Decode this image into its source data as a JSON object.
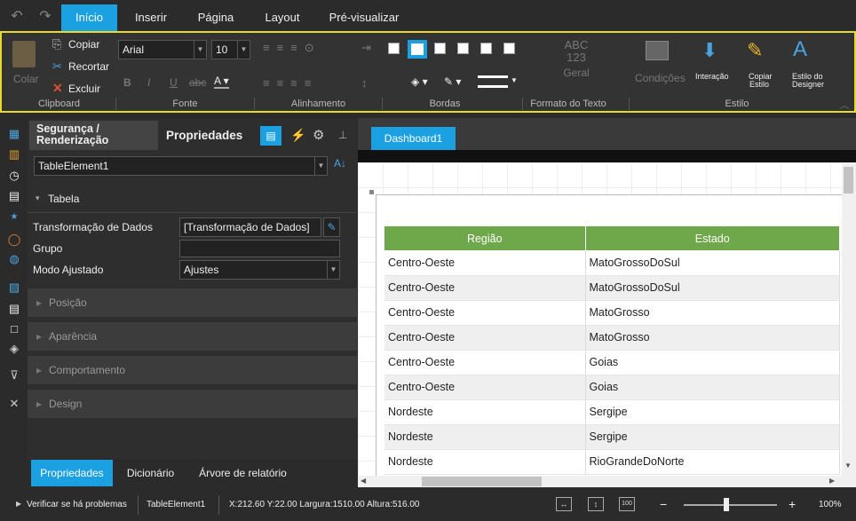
{
  "tabs": [
    {
      "label": "Início",
      "active": true
    },
    {
      "label": "Inserir",
      "active": false
    },
    {
      "label": "Página",
      "active": false
    },
    {
      "label": "Layout",
      "active": false
    },
    {
      "label": "Pré-visualizar",
      "active": false
    }
  ],
  "ribbon": {
    "clipboard": {
      "paste": "Colar",
      "copy": "Copiar",
      "cut": "Recortar",
      "delete": "Excluir",
      "group": "Clipboard"
    },
    "font": {
      "family": "Arial",
      "size": "10",
      "group": "Fonte"
    },
    "alignment": {
      "group": "Alinhamento"
    },
    "borders": {
      "group": "Bordas"
    },
    "text_format": {
      "abc": "ABC",
      "num": "123",
      "general": "Geral",
      "group": "Formato do Texto"
    },
    "style": {
      "conditions": "Condições",
      "interaction": "Interação",
      "copy_style_1": "Copiar",
      "copy_style_2": "Estilo",
      "designer_style_1": "Estilo do",
      "designer_style_2": "Designer",
      "group": "Estilo"
    }
  },
  "panel": {
    "tab_security_1": "Segurança /",
    "tab_security_2": "Renderização",
    "tab_properties": "Propriedades",
    "selector": "TableElement1",
    "table_section": "Tabela",
    "props": [
      {
        "label": "Transformação de Dados",
        "value": "[Transformação de Dados]"
      },
      {
        "label": "Grupo",
        "value": ""
      },
      {
        "label": "Modo Ajustado",
        "value": "Ajustes"
      }
    ],
    "sections": [
      "Posição",
      "Aparência",
      "Comportamento",
      "Design"
    ],
    "bottom_tabs": [
      "Propriedades",
      "Dicionário",
      "Árvore de relatório"
    ]
  },
  "canvas": {
    "tab": "Dashboard1",
    "headers": [
      "Região",
      "Estado"
    ],
    "rows": [
      [
        "Centro-Oeste",
        "MatoGrossoDoSul"
      ],
      [
        "Centro-Oeste",
        "MatoGrossoDoSul"
      ],
      [
        "Centro-Oeste",
        "MatoGrosso"
      ],
      [
        "Centro-Oeste",
        "MatoGrosso"
      ],
      [
        "Centro-Oeste",
        "Goias"
      ],
      [
        "Centro-Oeste",
        "Goias"
      ],
      [
        "Nordeste",
        "Sergipe"
      ],
      [
        "Nordeste",
        "Sergipe"
      ],
      [
        "Nordeste",
        "RioGrandeDoNorte"
      ]
    ]
  },
  "status": {
    "check": "Verificar se há problemas",
    "element": "TableElement1",
    "coords": "X:212.60 Y:22.00 Largura:1510.00 Altura:516.00",
    "zoom": "100%",
    "minus": "−",
    "plus": "+"
  },
  "colors": {
    "accent": "#1ba1e2",
    "header_green": "#6ea84a",
    "ribbon_border": "#e8d92d"
  }
}
